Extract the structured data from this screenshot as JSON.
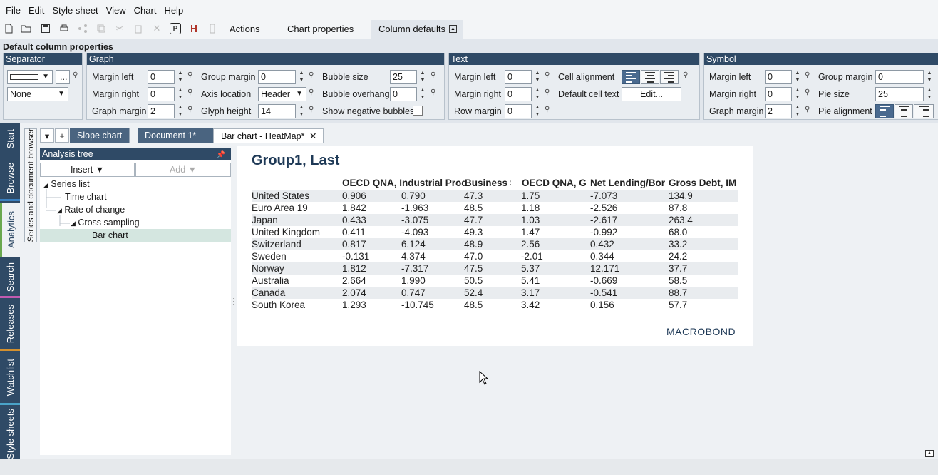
{
  "menu": [
    "File",
    "Edit",
    "Style sheet",
    "View",
    "Chart",
    "Help"
  ],
  "ribbon_tabs": [
    "Actions",
    "Chart properties",
    "Column defaults"
  ],
  "ribbon": {
    "heading": "Default column properties",
    "separator": {
      "title": "Separator",
      "style_value": "None",
      "more_label": "..."
    },
    "graph": {
      "title": "Graph",
      "margin_left_label": "Margin left",
      "margin_left": "0",
      "margin_right_label": "Margin right",
      "margin_right": "0",
      "graph_margin_label": "Graph margin",
      "graph_margin": "2",
      "group_margin_label": "Group margin",
      "group_margin": "0",
      "axis_location_label": "Axis location",
      "axis_location": "Header",
      "glyph_height_label": "Glyph height",
      "glyph_height": "14",
      "bubble_size_label": "Bubble size",
      "bubble_size": "25",
      "bubble_overhang_label": "Bubble overhang",
      "bubble_overhang": "0",
      "show_negative_label": "Show negative bubbles"
    },
    "text": {
      "title": "Text",
      "margin_left_label": "Margin left",
      "margin_left": "0",
      "margin_right_label": "Margin right",
      "margin_right": "0",
      "row_margin_label": "Row margin",
      "row_margin": "0",
      "cell_alignment_label": "Cell alignment",
      "default_cell_text_label": "Default cell text",
      "edit_label": "Edit..."
    },
    "symbol": {
      "title": "Symbol",
      "margin_left_label": "Margin left",
      "margin_left": "0",
      "margin_right_label": "Margin right",
      "margin_right": "0",
      "graph_margin_label": "Graph margin",
      "graph_margin": "2",
      "group_margin_label": "Group margin",
      "group_margin": "0",
      "pie_size_label": "Pie size",
      "pie_size": "25",
      "pie_alignment_label": "Pie alignment"
    }
  },
  "side_tabs": [
    "Start",
    "Browse",
    "Analytics",
    "Search",
    "Releases",
    "Watchlist",
    "Style sheets"
  ],
  "browser_strip": "Series and document browser",
  "doc_tabs": [
    "Slope chart",
    "Document 1*",
    "Bar chart - HeatMap*"
  ],
  "analysis": {
    "title": "Analysis tree",
    "insert_label": "Insert",
    "add_label": "Add",
    "tree": [
      "Series list",
      "Time chart",
      "Rate of change",
      "Cross sampling",
      "Bar chart"
    ]
  },
  "chart": {
    "title": "Group1, Last",
    "columns": [
      "OECD QNA, Industrial Production",
      "Business St",
      "OECD QNA, G",
      "Net Lending/Bor",
      "Gross Debt, IM"
    ],
    "rows": [
      {
        "country": "United States",
        "values": [
          "0.906",
          "0.790",
          "47.3",
          "1.75",
          "-7.073",
          "134.9"
        ]
      },
      {
        "country": "Euro Area 19",
        "values": [
          "1.842",
          "-1.963",
          "48.5",
          "1.18",
          "-2.526",
          "87.8"
        ]
      },
      {
        "country": "Japan",
        "values": [
          "0.433",
          "-3.075",
          "47.7",
          "1.03",
          "-2.617",
          "263.4"
        ]
      },
      {
        "country": "United Kingdom",
        "values": [
          "0.411",
          "-4.093",
          "49.3",
          "1.47",
          "-0.992",
          "68.0"
        ]
      },
      {
        "country": "Switzerland",
        "values": [
          "0.817",
          "6.124",
          "48.9",
          "2.56",
          "0.432",
          "33.2"
        ]
      },
      {
        "country": "Sweden",
        "values": [
          "-0.131",
          "4.374",
          "47.0",
          "-2.01",
          "0.344",
          "24.2"
        ]
      },
      {
        "country": "Norway",
        "values": [
          "1.812",
          "-7.317",
          "47.5",
          "5.37",
          "12.171",
          "37.7"
        ]
      },
      {
        "country": "Australia",
        "values": [
          "2.664",
          "1.990",
          "50.5",
          "5.41",
          "-0.669",
          "58.5"
        ]
      },
      {
        "country": "Canada",
        "values": [
          "2.074",
          "0.747",
          "52.4",
          "3.17",
          "-0.541",
          "88.7"
        ]
      },
      {
        "country": "South Korea",
        "values": [
          "1.293",
          "-10.745",
          "48.5",
          "3.42",
          "0.156",
          "57.7"
        ]
      }
    ],
    "logo": "MACROBOND"
  }
}
